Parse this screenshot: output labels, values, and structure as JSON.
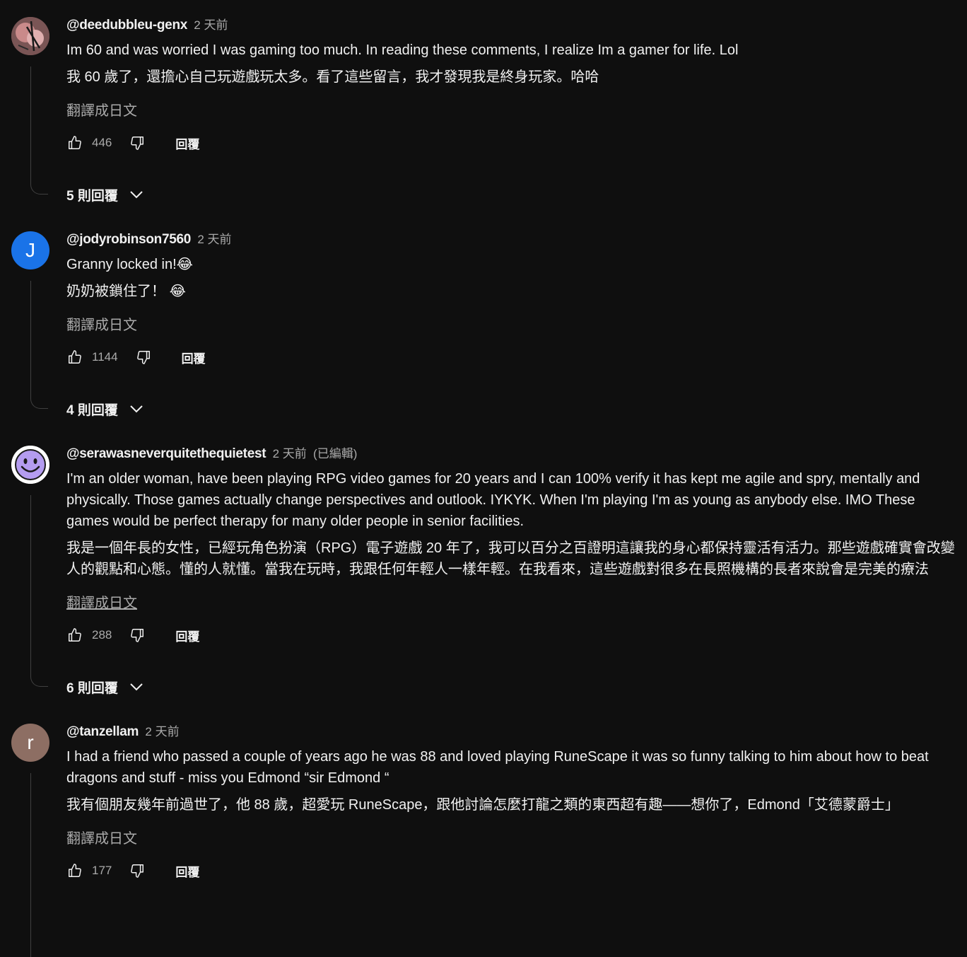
{
  "colors": {
    "background": "#0f0f0f",
    "text": "#f1f1f1",
    "secondary_text": "#aaaaaa",
    "avatar_j": "#1a73e8",
    "avatar_r": "#8d6e63",
    "avatar_smiley": "#b49cf0"
  },
  "ui": {
    "translate_label": "翻譯成日文",
    "reply_label": "回覆"
  },
  "comments": [
    {
      "author": "@deedubbleu-genx",
      "time": "2 天前",
      "edited": "",
      "avatar_type": "photo",
      "avatar_letter": "",
      "text_lines": [
        "Im 60 and was worried I was gaming too much. In reading these comments, I realize Im a gamer for life. Lol"
      ],
      "translated_lines": [
        "我 60 歲了，還擔心自己玩遊戲玩太多。看了這些留言，我才發現我是終身玩家。哈哈"
      ],
      "likes": "446",
      "replies_label": "5 則回覆"
    },
    {
      "author": "@jodyrobinson7560",
      "time": "2 天前",
      "edited": "",
      "avatar_type": "letter",
      "avatar_letter": "J",
      "text_lines": [
        "Granny locked in!"
      ],
      "translated_lines": [
        "奶奶被鎖住了！"
      ],
      "emoji": "😂",
      "likes": "1144",
      "replies_label": "4 則回覆"
    },
    {
      "author": "@serawasneverquitethequietest",
      "time": "2 天前",
      "edited": "(已編輯)",
      "avatar_type": "smiley",
      "avatar_letter": "",
      "text_lines": [
        "I'm an older woman, have been playing RPG video games for 20 years and I can 100% verify it has kept me agile and spry, mentally and",
        "physically.  Those games actually change perspectives and outlook.  IYKYK.  When I'm playing I'm as young as anybody else.  IMO These",
        "games would be perfect therapy for many older people in senior facilities."
      ],
      "translated_lines": [
        "我是一個年長的女性，已經玩角色扮演（RPG）電子遊戲 20 年了，我可以百分之百證明這讓我的身心都保持靈活有活力。那些遊戲確實會改變",
        "人的觀點和心態。懂的人就懂。當我在玩時，我跟任何年輕人一樣年輕。在我看來，這些遊戲對很多在長照機構的長者來說會是完美的療法"
      ],
      "likes": "288",
      "replies_label": "6 則回覆"
    },
    {
      "author": "@tanzellam",
      "time": "2 天前",
      "edited": "",
      "avatar_type": "letter",
      "avatar_letter": "r",
      "text_lines": [
        "I had a friend who passed a couple of years ago he was 88 and loved playing RuneScape it was so funny talking to him about how to beat",
        "dragons and stuff - miss you Edmond “sir Edmond “"
      ],
      "translated_lines": [
        "我有個朋友幾年前過世了，他 88 歲，超愛玩 RuneScape，跟他討論怎麼打龍之類的東西超有趣——想你了，Edmond「艾德蒙爵士」"
      ],
      "likes": "177",
      "replies_label": ""
    }
  ]
}
